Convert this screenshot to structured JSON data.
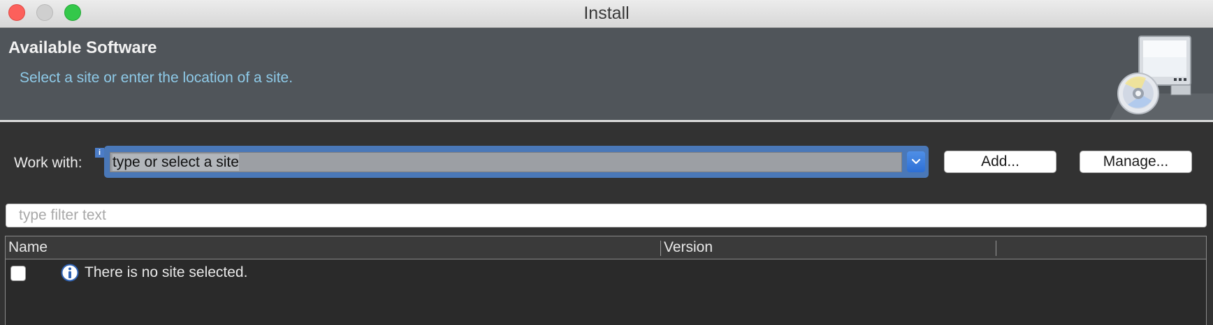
{
  "window": {
    "title": "Install"
  },
  "banner": {
    "title": "Available Software",
    "message": "Select a site or enter the location of a site.",
    "icon": "software-install-monitor-cd-icon"
  },
  "work_with": {
    "label": "Work with:",
    "value": "type or select a site",
    "info_marker": "i",
    "add_label": "Add...",
    "manage_label": "Manage..."
  },
  "filter": {
    "placeholder": "type filter text",
    "value": ""
  },
  "table": {
    "columns": [
      "Name",
      "Version"
    ],
    "rows": [
      {
        "checked": false,
        "icon": "info-icon",
        "text": "There is no site selected."
      }
    ]
  },
  "colors": {
    "accent": "#4a78b8",
    "banner_message": "#8ecae8",
    "close": "#fc605b",
    "maximize": "#34c84a"
  }
}
